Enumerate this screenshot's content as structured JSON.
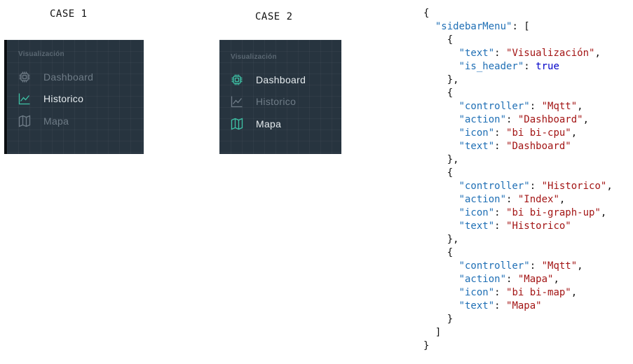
{
  "case1": {
    "title": "CASE 1",
    "header": "Visualización",
    "items": [
      {
        "label": "Dashboard",
        "icon": "cpu-icon",
        "state": "dim"
      },
      {
        "label": "Historico",
        "icon": "graph-up-icon",
        "state": "active"
      },
      {
        "label": "Mapa",
        "icon": "map-icon",
        "state": "dim"
      }
    ]
  },
  "case2": {
    "title": "CASE 2",
    "header": "Visualización",
    "items": [
      {
        "label": "Dashboard",
        "icon": "cpu-icon",
        "state": "active"
      },
      {
        "label": "Historico",
        "icon": "graph-up-icon",
        "state": "dim"
      },
      {
        "label": "Mapa",
        "icon": "map-icon",
        "state": "active"
      }
    ]
  },
  "code": {
    "lines": [
      "{",
      "  \"sidebarMenu\": [",
      "    {",
      "      \"text\": \"Visualización\",",
      "      \"is_header\": true",
      "    },",
      "    {",
      "      \"controller\": \"Mqtt\",",
      "      \"action\": \"Dashboard\",",
      "      \"icon\": \"bi bi-cpu\",",
      "      \"text\": \"Dashboard\"",
      "    },",
      "    {",
      "      \"controller\": \"Historico\",",
      "      \"action\": \"Index\",",
      "      \"icon\": \"bi bi-graph-up\",",
      "      \"text\": \"Historico\"",
      "    },",
      "    {",
      "      \"controller\": \"Mqtt\",",
      "      \"action\": \"Mapa\",",
      "      \"icon\": \"bi bi-map\",",
      "      \"text\": \"Mapa\"",
      "    }",
      "  ]",
      "}"
    ]
  },
  "colors": {
    "panel_bg": "#27343f",
    "accent": "#3ec3a6",
    "dim_text": "#6f7c87",
    "bright_text": "#e6ecef"
  }
}
